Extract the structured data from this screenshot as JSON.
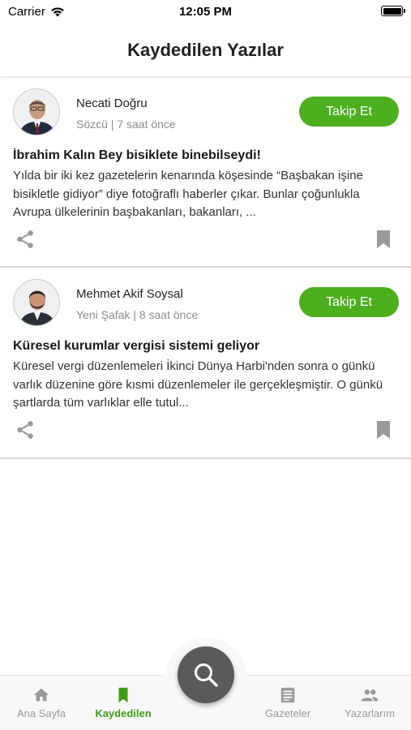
{
  "status_bar": {
    "carrier": "Carrier",
    "time": "12:05 PM"
  },
  "header": {
    "title": "Kaydedilen Yazılar"
  },
  "articles": [
    {
      "author": "Necati Doğru",
      "meta": "Sözcü | 7 saat önce",
      "follow_label": "Takip Et",
      "title": "İbrahim Kalın Bey bisiklete binebilseydi!",
      "excerpt": "Yılda bir iki kez gazetelerin kenarında köşesinde “Başbakan işine bisikletle gidiyor” diye fotoğraflı haberler çıkar. Bunlar çoğunlukla Avrupa ülkelerinin başbakanları, bakanları, ..."
    },
    {
      "author": "Mehmet Akif Soysal",
      "meta": "Yeni Şafak | 8 saat önce",
      "follow_label": "Takip Et",
      "title": "Küresel kurumlar vergisi sistemi geliyor",
      "excerpt": "Küresel vergi düzenlemeleri İkinci Dünya Harbi'nden sonra o günkü varlık düzenine göre kısmi düzenlemeler ile gerçekleşmiştir. O günkü şartlarda tüm varlıklar elle tutul..."
    }
  ],
  "tabbar": {
    "items": [
      {
        "label": "Ana Sayfa",
        "icon": "home-icon",
        "active": false
      },
      {
        "label": "Kaydedilen",
        "icon": "bookmark-icon",
        "active": true
      },
      {
        "label": "Gazeteler",
        "icon": "newspaper-icon",
        "active": false
      },
      {
        "label": "Yazarlarım",
        "icon": "people-icon",
        "active": false
      }
    ],
    "fab_icon": "search-icon"
  },
  "colors": {
    "accent": "#4caf1e",
    "active_tab": "#3f9d18",
    "inactive": "#9a9a9a",
    "fab": "#5a5a5a"
  }
}
